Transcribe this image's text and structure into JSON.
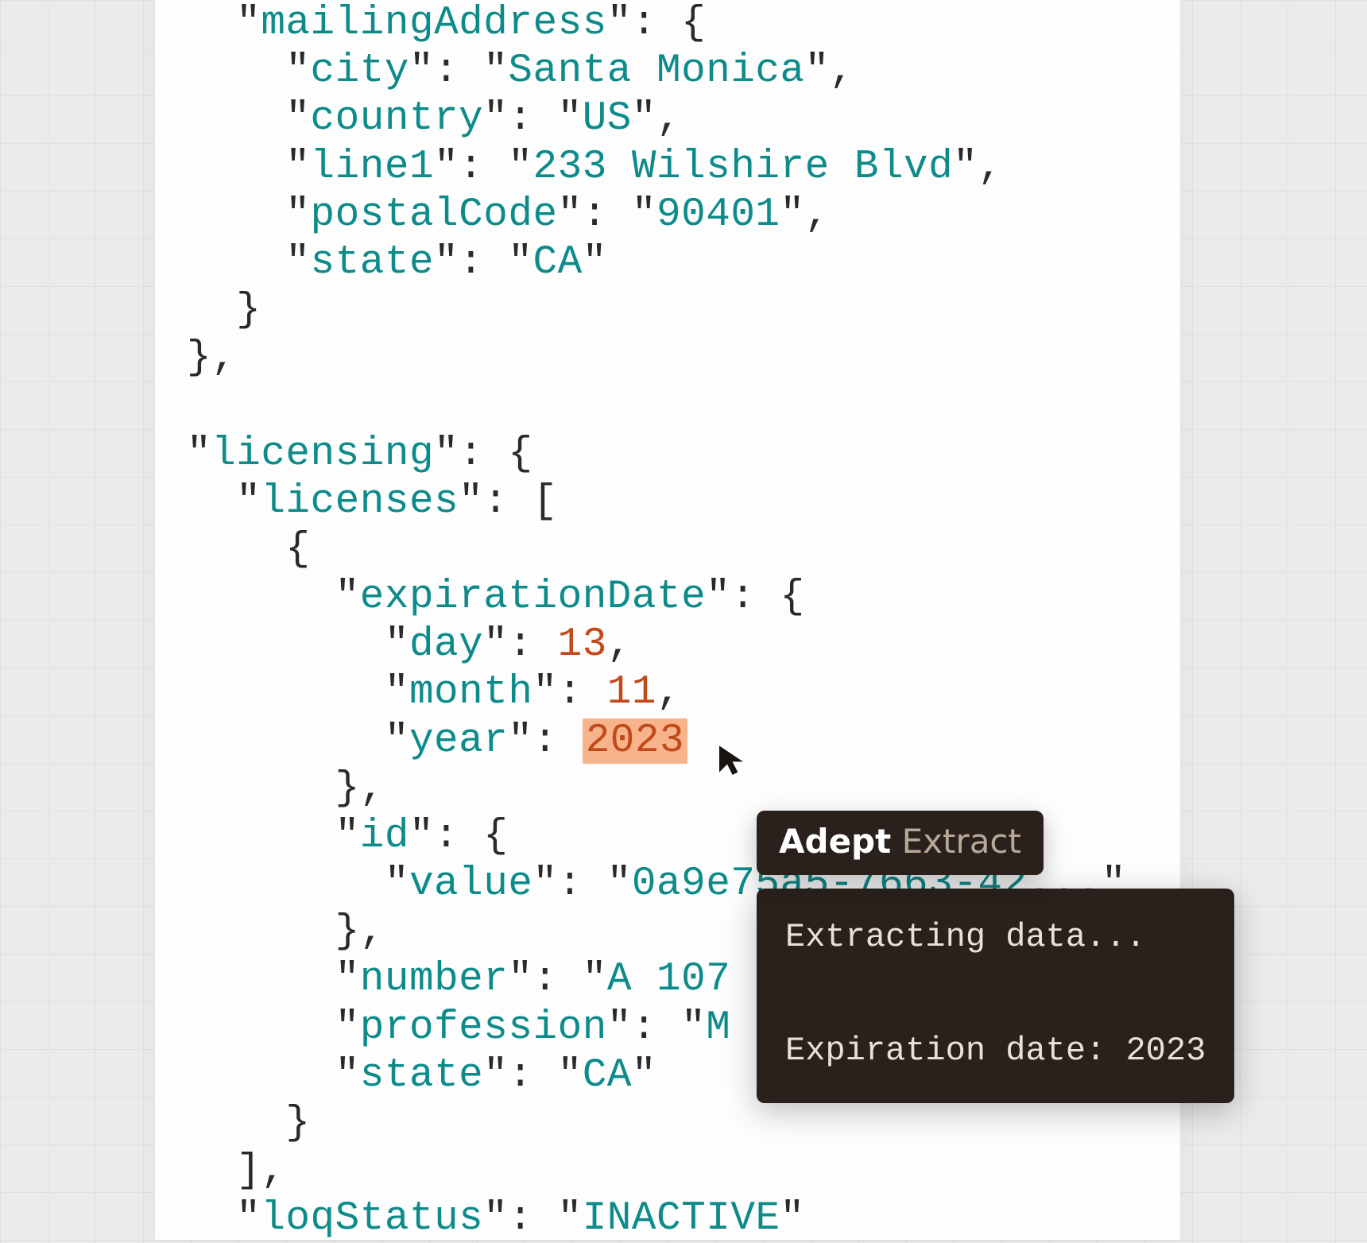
{
  "code": {
    "mailingAddress": {
      "label": "mailingAddress",
      "city": {
        "key": "city",
        "value": "Santa Monica"
      },
      "country": {
        "key": "country",
        "value": "US"
      },
      "line1": {
        "key": "line1",
        "value": "233 Wilshire Blvd"
      },
      "postalCode": {
        "key": "postalCode",
        "value": "90401"
      },
      "state": {
        "key": "state",
        "value": "CA"
      }
    },
    "licensing": {
      "label": "licensing",
      "licenses": {
        "label": "licenses"
      },
      "expirationDate": {
        "label": "expirationDate",
        "day": {
          "key": "day",
          "value": "13"
        },
        "month": {
          "key": "month",
          "value": "11"
        },
        "year": {
          "key": "year",
          "value": "2023"
        }
      },
      "id": {
        "label": "id",
        "value": {
          "key": "value",
          "value": "0a9e75a5-7663-42..."
        }
      },
      "number": {
        "key": "number",
        "value": "A 107"
      },
      "profession": {
        "key": "profession",
        "value": "M"
      },
      "state": {
        "key": "state",
        "value": "CA"
      },
      "loqStatus": {
        "key": "loqStatus",
        "value": "INACTIVE"
      }
    }
  },
  "tooltip": {
    "brand": "Adept",
    "mode": "Extract",
    "line1": "Extracting data...",
    "line2": "Expiration date: 2023"
  },
  "colors": {
    "key_string": "#0d8b8b",
    "number": "#c14a1a",
    "highlight": "#f7b38a",
    "tooltip_bg": "#2a211c"
  }
}
